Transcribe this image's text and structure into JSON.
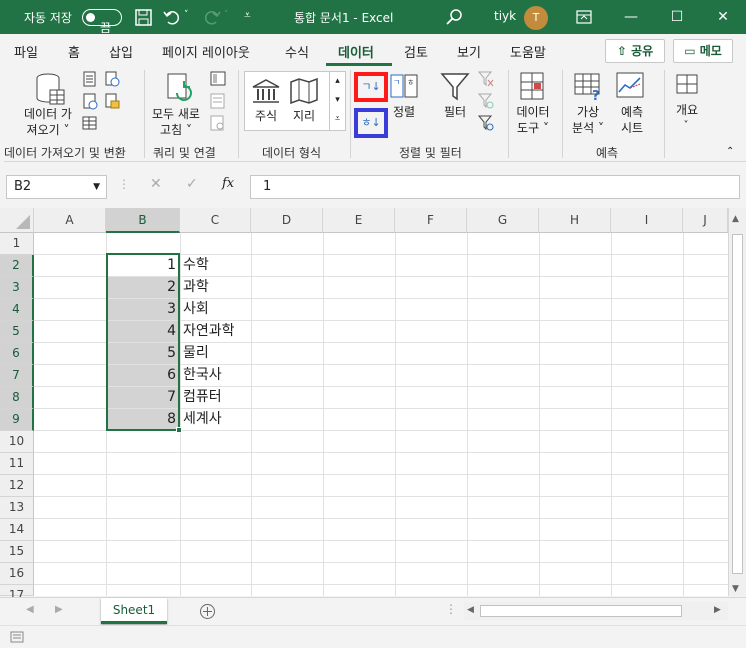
{
  "titlebar": {
    "autosave_label": "자동 저장",
    "autosave_state": "끔",
    "doc_title": "통합 문서1  -  Excel",
    "user_name": "tiyk",
    "avatar_initial": "T"
  },
  "tabs": [
    "파일",
    "홈",
    "삽입",
    "페이지 레이아웃",
    "수식",
    "데이터",
    "검토",
    "보기",
    "도움말"
  ],
  "tab_active": "데이터",
  "share_label": "공유",
  "memo_label": "메모",
  "ribbon": {
    "get_data_label_1": "데이터 가",
    "get_data_label_2": "져오기 ˅",
    "refresh_all_label_1": "모두 새로",
    "refresh_all_label_2": "고침 ˅",
    "stocks_label": "주식",
    "geography_label": "지리",
    "sort_asc_glyph": "ㄱ↓",
    "sort_desc_glyph": "ㅎ↓",
    "sort_label": "정렬",
    "filter_label": "필터",
    "data_tools_label_1": "데이터",
    "data_tools_label_2": "도구 ˅",
    "whatif_label_1": "가상",
    "whatif_label_2": "분석 ˅",
    "forecast_label_1": "예측",
    "forecast_label_2": "시트",
    "outline_label": "개요",
    "groups": [
      "데이터 가져오기 및 변환",
      "쿼리 및 연결",
      "데이터 형식",
      "정렬 및 필터",
      "예측"
    ]
  },
  "formula_bar": {
    "name_box": "B2",
    "formula": "1",
    "fx": "fx"
  },
  "columns": [
    "A",
    "B",
    "C",
    "D",
    "E",
    "F",
    "G",
    "H",
    "I",
    "J"
  ],
  "rows": [
    "1",
    "2",
    "3",
    "4",
    "5",
    "6",
    "7",
    "8",
    "9",
    "10",
    "11",
    "12",
    "13",
    "14",
    "15",
    "16",
    "17"
  ],
  "data_cells": [
    {
      "b": "1",
      "c": "수학"
    },
    {
      "b": "2",
      "c": "과학"
    },
    {
      "b": "3",
      "c": "사회"
    },
    {
      "b": "4",
      "c": "자연과학"
    },
    {
      "b": "5",
      "c": "물리"
    },
    {
      "b": "6",
      "c": "한국사"
    },
    {
      "b": "7",
      "c": "컴퓨터"
    },
    {
      "b": "8",
      "c": "세계사"
    }
  ],
  "sheet_tab": "Sheet1",
  "colors": {
    "excel_green": "#217346",
    "highlight_red": "#ff1a1a",
    "highlight_blue": "#3b3bd9"
  }
}
